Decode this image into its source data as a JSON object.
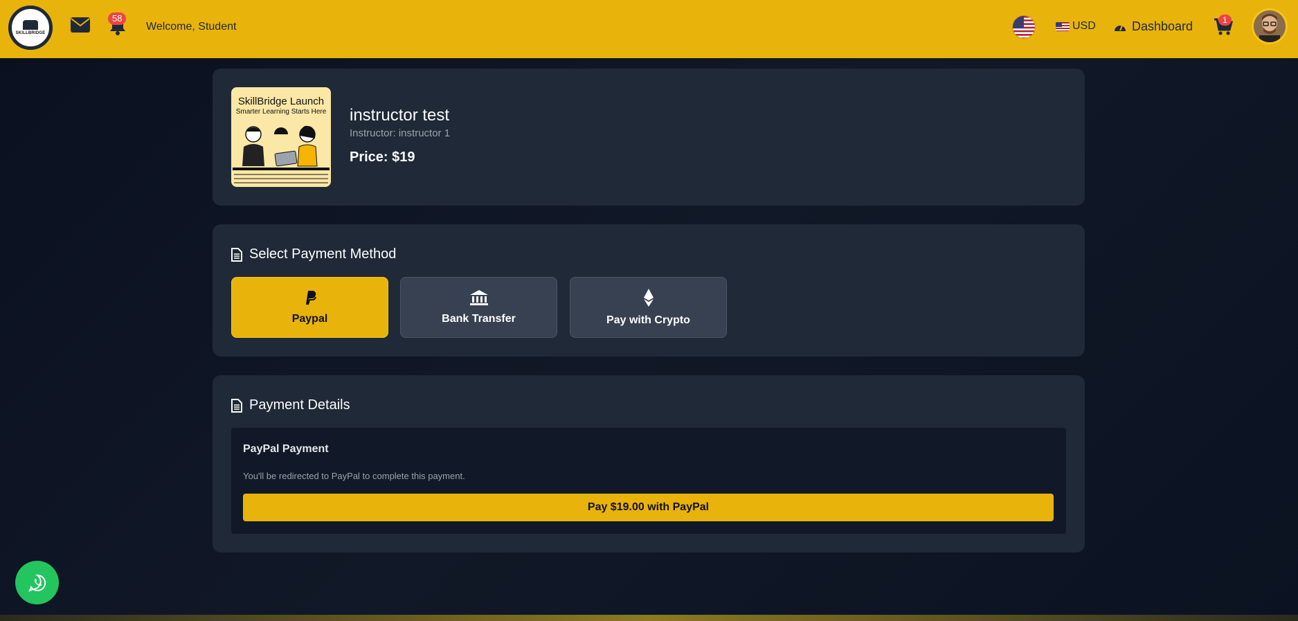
{
  "header": {
    "logo_text": "SKILLBRIDGE",
    "notification_count": "58",
    "welcome_text": "Welcome, Student",
    "currency_label": "USD",
    "dashboard_label": "Dashboard",
    "cart_count": "1"
  },
  "course": {
    "thumbnail_title": "SkillBridge Launch",
    "thumbnail_subtitle": "Smarter Learning Starts Here",
    "title": "instructor test",
    "instructor": "Instructor: instructor 1",
    "price": "Price: $19"
  },
  "payment_methods": {
    "section_title": "Select Payment Method",
    "methods": [
      {
        "label": "Paypal",
        "icon": "paypal-icon",
        "selected": true
      },
      {
        "label": "Bank Transfer",
        "icon": "bank-icon",
        "selected": false
      },
      {
        "label": "Pay with Crypto",
        "icon": "ethereum-icon",
        "selected": false
      }
    ]
  },
  "payment_details": {
    "section_title": "Payment Details",
    "box_title": "PayPal Payment",
    "description": "You'll be redirected to PayPal to complete this payment.",
    "pay_button_label": "Pay $19.00 with PayPal"
  },
  "colors": {
    "accent": "#e8b30a",
    "card_bg": "#1f2937",
    "badge": "#ef4444",
    "whatsapp": "#22c55e"
  }
}
